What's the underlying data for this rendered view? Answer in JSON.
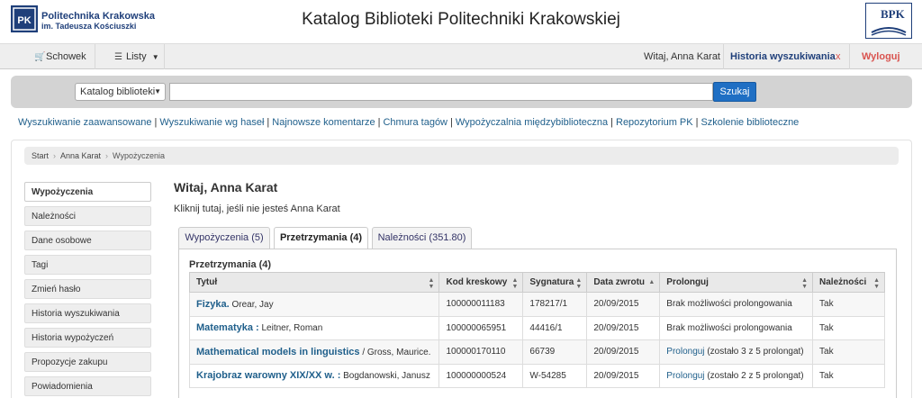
{
  "header": {
    "logo_line1": "Politechnika Krakowska",
    "logo_line2": "im. Tadeusza Kościuszki",
    "title": "Katalog Biblioteki Politechniki Krakowskiej",
    "bpk_logo": "BPK"
  },
  "navbar": {
    "schowek": "Schowek",
    "listy": "Listy",
    "welcome": "Witaj, Anna Karat",
    "history": "Historia wyszukiwania",
    "history_close": "x",
    "logout": "Wyloguj"
  },
  "search": {
    "scope": "Katalog biblioteki",
    "query": "",
    "button": "Szukaj"
  },
  "links": [
    "Wyszukiwanie zaawansowane",
    "Wyszukiwanie wg haseł",
    "Najnowsze komentarze",
    "Chmura tagów",
    "Wypożyczalnia międzybiblioteczna",
    "Repozytorium PK",
    "Szkolenie biblioteczne"
  ],
  "breadcrumb": [
    "Start",
    "Anna Karat",
    "Wypożyczenia"
  ],
  "sidebar": [
    "Wypożyczenia",
    "Należności",
    "Dane osobowe",
    "Tagi",
    "Zmień hasło",
    "Historia wyszukiwania",
    "Historia wypożyczeń",
    "Propozycje zakupu",
    "Powiadomienia"
  ],
  "content": {
    "greeting": "Witaj, Anna Karat",
    "not_me": "Kliknij tutaj, jeśli nie jesteś Anna Karat",
    "tabs": [
      "Wypożyczenia (5)",
      "Przetrzymania (4)",
      "Należności (351.80)"
    ],
    "panel_title": "Przetrzymania (4)",
    "columns": [
      "Tytuł",
      "Kod kreskowy",
      "Sygnatura",
      "Data zwrotu",
      "Prolonguj",
      "Należności"
    ],
    "rows": [
      {
        "title": "Fizyka.",
        "author": "Orear, Jay",
        "barcode": "100000011183",
        "signature": "178217/1",
        "due": "20/09/2015",
        "renew": "Brak możliwości prolongowania",
        "renew_link": "",
        "fee": "Tak"
      },
      {
        "title": "Matematyka :",
        "author": "Leitner, Roman",
        "barcode": "100000065951",
        "signature": "44416/1",
        "due": "20/09/2015",
        "renew": "Brak możliwości prolongowania",
        "renew_link": "",
        "fee": "Tak"
      },
      {
        "title": "Mathematical models in linguistics",
        "author": "/ Gross, Maurice.",
        "barcode": "100000170110",
        "signature": "66739",
        "due": "20/09/2015",
        "renew": "(zostało 3 z 5 prolongat)",
        "renew_link": "Prolonguj",
        "fee": "Tak"
      },
      {
        "title": "Krajobraz warowny XIX/XX w. :",
        "author": "Bogdanowski, Janusz",
        "barcode": "100000000524",
        "signature": "W-54285",
        "due": "20/09/2015",
        "renew": "(zostało 2 z 5 prolongat)",
        "renew_link": "Prolonguj",
        "fee": "Tak"
      }
    ]
  },
  "colors": {
    "link": "#1f5f8b",
    "search_button": "#1f6fc4",
    "history": "#1f3f7a",
    "logout": "#d9534f"
  }
}
